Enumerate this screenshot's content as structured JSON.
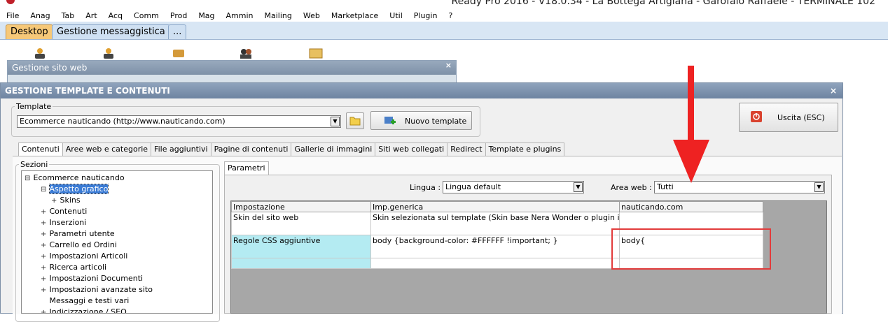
{
  "window": {
    "title": "Ready Pro 2016 - V18.0.34 - La Bottega Artigiana - Garofalo Raffaele - TERMINALE 102"
  },
  "menubar": [
    "File",
    "Anag",
    "Tab",
    "Art",
    "Acq",
    "Comm",
    "Prod",
    "Mag",
    "Ammin",
    "Mailing",
    "Web",
    "Marketplace",
    "Util",
    "Plugin",
    "?"
  ],
  "desktop_tabs": [
    "Desktop",
    "Gestione messaggistica",
    "..."
  ],
  "sito_window": {
    "title": "Gestione sito web",
    "close": "×"
  },
  "main_window": {
    "title": "GESTIONE TEMPLATE E CONTENUTI",
    "close": "×",
    "template_group": {
      "legend": "Template",
      "selected": "Ecommerce nauticando (http://www.nauticando.com)",
      "new_button": "Nuovo template"
    },
    "exit_button": "Uscita (ESC)",
    "tabs": [
      "Contenuti",
      "Aree web e categorie",
      "File aggiuntivi",
      "Pagine di contenuti",
      "Gallerie di immagini",
      "Siti web collegati",
      "Redirect",
      "Template e plugins"
    ],
    "active_tab": "Contenuti",
    "sections_group": {
      "legend": "Sezioni",
      "tree": [
        {
          "label": "Ecommerce nauticando",
          "marker": "⊟",
          "level": 0
        },
        {
          "label": "Aspetto grafico",
          "marker": "⊟",
          "level": 1,
          "selected": true
        },
        {
          "label": "Skins",
          "marker": "+",
          "level": 2
        },
        {
          "label": "Contenuti",
          "marker": "+",
          "level": 1
        },
        {
          "label": "Inserzioni",
          "marker": "+",
          "level": 1
        },
        {
          "label": "Parametri utente",
          "marker": "+",
          "level": 1
        },
        {
          "label": "Carrello ed Ordini",
          "marker": "+",
          "level": 1
        },
        {
          "label": "Impostazioni Articoli",
          "marker": "+",
          "level": 1
        },
        {
          "label": "Ricerca articoli",
          "marker": "+",
          "level": 1
        },
        {
          "label": "Impostazioni Documenti",
          "marker": "+",
          "level": 1
        },
        {
          "label": "Impostazioni avanzate sito",
          "marker": "+",
          "level": 1
        },
        {
          "label": "Messaggi e testi vari",
          "marker": "",
          "level": 1
        },
        {
          "label": "Indicizzazione / SEO",
          "marker": "+",
          "level": 1
        }
      ]
    },
    "params_tab": "Parametri",
    "lingua": {
      "label": "Lingua :",
      "value": "Lingua default"
    },
    "area_web": {
      "label": "Area web :",
      "value": "Tutti"
    },
    "grid": {
      "columns": [
        "Impostazione",
        "Imp.generica",
        "nauticando.com"
      ],
      "rows": [
        [
          "Skin del sito web",
          "Skin selezionata sul template (Skin base Nera Wonder o plugin installato)",
          ""
        ],
        [
          "Regole CSS aggiuntive",
          "body {background-color: #FFFFFF !important; }",
          "body{"
        ],
        [
          "",
          "",
          ""
        ]
      ]
    }
  },
  "colors": {
    "annotation": "#e23b3b",
    "highlight_row": "#b4ebf2",
    "desktop_tab_active": "#f6c878"
  }
}
